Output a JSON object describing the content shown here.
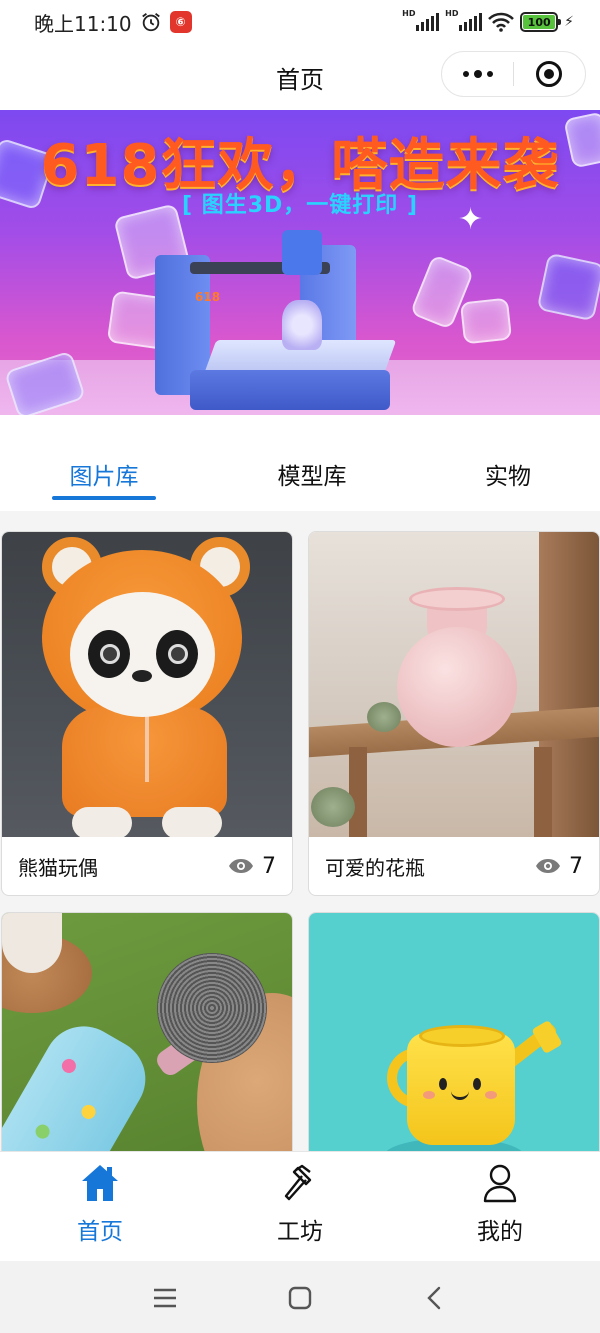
{
  "status_bar": {
    "time": "晚上11:10",
    "app_badge": "⑥",
    "signal_label_1": "HD",
    "signal_label_2": "HD",
    "battery": "100"
  },
  "nav": {
    "title": "首页"
  },
  "banner": {
    "headline": "618狂欢，嗒造来袭",
    "subline": "[ 图生3D，一键打印 ]",
    "printer_label": "618"
  },
  "tabs": [
    {
      "label": "图片库",
      "active": true
    },
    {
      "label": "模型库",
      "active": false
    },
    {
      "label": "实物",
      "active": false
    }
  ],
  "cards": [
    {
      "title": "熊猫玩偶",
      "views": "7"
    },
    {
      "title": "可爱的花瓶",
      "views": "7"
    },
    {
      "title": "",
      "views": ""
    },
    {
      "title": "",
      "views": ""
    }
  ],
  "tabbar": [
    {
      "label": "首页",
      "icon": "home-icon",
      "active": true
    },
    {
      "label": "工坊",
      "icon": "hammer-icon",
      "active": false
    },
    {
      "label": "我的",
      "icon": "user-icon",
      "active": false
    }
  ],
  "colors": {
    "accent": "#1677d9",
    "banner_title": "#ff5a1f",
    "banner_sub": "#2ad3ff",
    "battery": "#57c23b"
  }
}
